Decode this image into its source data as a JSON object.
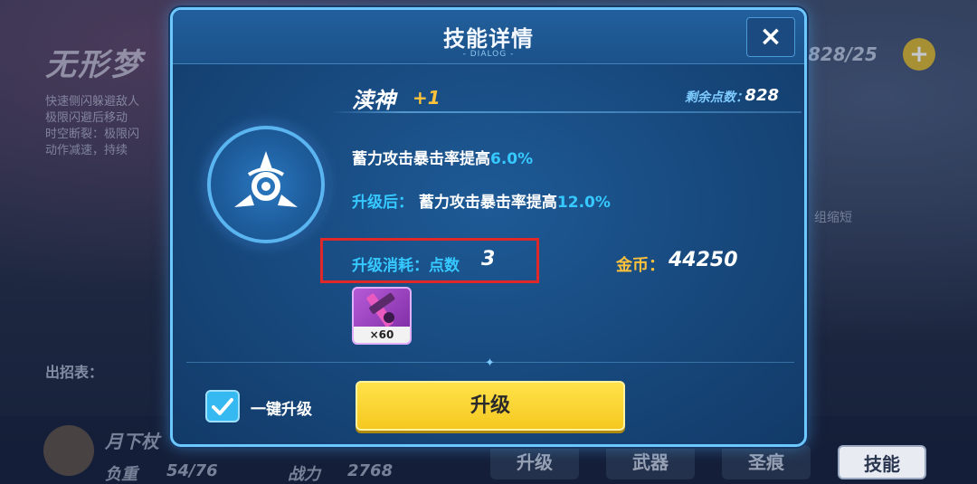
{
  "background": {
    "title": "无形梦",
    "description": "快速侧闪躲避敌人\n极限闪避后移动\n时空断裂：极限闪\n动作减速，持续",
    "counter": "828/25",
    "side_text": "组缩短",
    "moves_label": "出招表：",
    "character_name": "月下杖",
    "stat_weight_label": "负重",
    "stat_weight_value": "54/76",
    "stat_power_label": "战力",
    "stat_power_value": "2768",
    "tabs": [
      "升级",
      "武器",
      "圣痕",
      "技能"
    ]
  },
  "dialog": {
    "title": "技能详情",
    "subtitle": "- DIALOG -",
    "close_label": "×",
    "skill_name": "渎神",
    "skill_level": "+1",
    "points_label": "剩余点数：",
    "points_value": "828",
    "effect_now_text": "蓄力攻击暴击率提高",
    "effect_now_value": "6.0%",
    "effect_next_prefix": "升级后：",
    "effect_next_text": "蓄力攻击暴击率提高",
    "effect_next_value": "12.0%",
    "cost_label": "升级消耗：点数",
    "cost_value": "3",
    "gold_label": "金币：",
    "gold_value": "44250",
    "item_count": "×60",
    "one_click_label": "一键升级",
    "one_click_checked": true,
    "upgrade_button": "升级"
  },
  "colors": {
    "accent_cyan": "#36c9ff",
    "gold": "#ffc23a",
    "button_yellow": "#f5c820",
    "highlight_red": "#e02828"
  },
  "icons": [
    "close-icon",
    "skill-emblem-icon",
    "material-item-icon",
    "checkmark-icon",
    "plus-icon"
  ]
}
